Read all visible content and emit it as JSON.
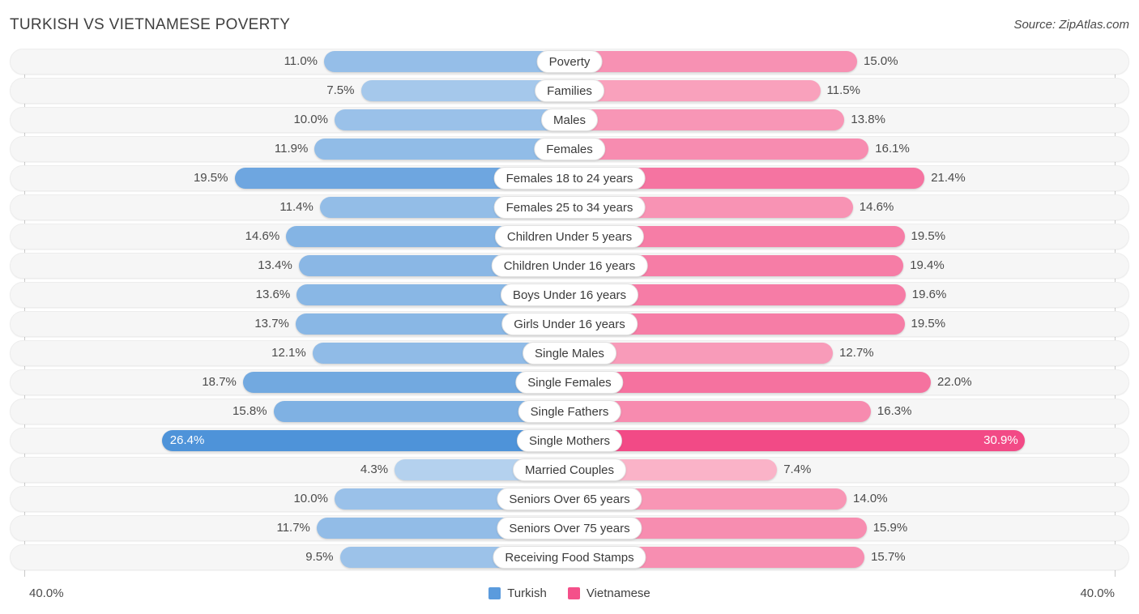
{
  "header": {
    "title": "TURKISH VS VIETNAMESE POVERTY",
    "source": "Source: ZipAtlas.com"
  },
  "footer": {
    "axis_max_left": "40.0%",
    "axis_max_right": "40.0%",
    "legend": [
      {
        "label": "Turkish",
        "color": "#5b9bdd"
      },
      {
        "label": "Vietnamese",
        "color": "#f4508a"
      }
    ]
  },
  "colors": {
    "left_min": "#b4d1ee",
    "left_max": "#4e93d9",
    "right_min": "#fab3c8",
    "right_max": "#f24a86",
    "track": "#f6f6f6",
    "axis": "#c9c9c9"
  },
  "chart_data": {
    "type": "bar",
    "title": "TURKISH VS VIETNAMESE POVERTY",
    "subtitle": "Source: ZipAtlas.com",
    "orientation": "horizontal-diverging",
    "xlabel": "",
    "ylabel": "",
    "xlim": [
      40.0,
      40.0
    ],
    "axis_max": 40.0,
    "unit": "%",
    "grid": false,
    "legend_position": "bottom-center",
    "categories": [
      "Poverty",
      "Families",
      "Males",
      "Females",
      "Females 18 to 24 years",
      "Females 25 to 34 years",
      "Children Under 5 years",
      "Children Under 16 years",
      "Boys Under 16 years",
      "Girls Under 16 years",
      "Single Males",
      "Single Females",
      "Single Fathers",
      "Single Mothers",
      "Married Couples",
      "Seniors Over 65 years",
      "Seniors Over 75 years",
      "Receiving Food Stamps"
    ],
    "series": [
      {
        "name": "Turkish",
        "color": "#5b9bdd",
        "side": "left",
        "values": [
          11.0,
          7.5,
          10.0,
          11.9,
          19.5,
          11.4,
          14.6,
          13.4,
          13.6,
          13.7,
          12.1,
          18.7,
          15.8,
          26.4,
          4.3,
          10.0,
          11.7,
          9.5
        ],
        "labels": [
          "11.0%",
          "7.5%",
          "10.0%",
          "11.9%",
          "19.5%",
          "11.4%",
          "14.6%",
          "13.4%",
          "13.6%",
          "13.7%",
          "12.1%",
          "18.7%",
          "15.8%",
          "26.4%",
          "4.3%",
          "10.0%",
          "11.7%",
          "9.5%"
        ]
      },
      {
        "name": "Vietnamese",
        "color": "#f4508a",
        "side": "right",
        "values": [
          15.0,
          11.5,
          13.8,
          16.1,
          21.4,
          14.6,
          19.5,
          19.4,
          19.6,
          19.5,
          12.7,
          22.0,
          16.3,
          30.9,
          7.4,
          14.0,
          15.9,
          15.7
        ],
        "labels": [
          "15.0%",
          "11.5%",
          "13.8%",
          "16.1%",
          "21.4%",
          "14.6%",
          "19.5%",
          "19.4%",
          "19.6%",
          "19.5%",
          "12.7%",
          "22.0%",
          "16.3%",
          "30.9%",
          "7.4%",
          "14.0%",
          "15.9%",
          "15.7%"
        ]
      }
    ]
  }
}
